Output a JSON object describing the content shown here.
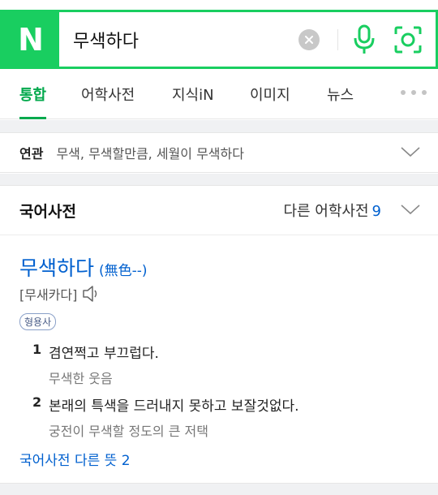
{
  "search": {
    "logo_letter": "N",
    "query": "무색하다",
    "icons": [
      "clear-icon",
      "microphone-icon",
      "lens-icon"
    ],
    "brand_color": "#19ce60"
  },
  "tabs": [
    {
      "label": "통합",
      "active": true
    },
    {
      "label": "어학사전",
      "active": false
    },
    {
      "label": "지식iN",
      "active": false
    },
    {
      "label": "이미지",
      "active": false
    },
    {
      "label": "뉴스",
      "active": false
    }
  ],
  "related": {
    "label": "연관",
    "text": "무색, 무색할만큼, 세월이 무색하다"
  },
  "dictionary": {
    "title": "국어사전",
    "other_label": "다른 어학사전",
    "other_count": "9",
    "entry": {
      "word": "무색하다",
      "hanja": "(無色--)",
      "pronunciation": "[무새카다]",
      "part_of_speech": "형용사",
      "senses": [
        {
          "num": "1",
          "definition": "겸연쩍고 부끄럽다.",
          "example": "무색한 웃음"
        },
        {
          "num": "2",
          "definition": "본래의 특색을 드러내지 못하고 보잘것없다.",
          "example": "궁전이 무색할 정도의 큰 저택"
        }
      ],
      "more_link": "국어사전 다른 뜻 2"
    }
  },
  "colors": {
    "active_tab": "#03a94d",
    "link": "#0060cf"
  }
}
